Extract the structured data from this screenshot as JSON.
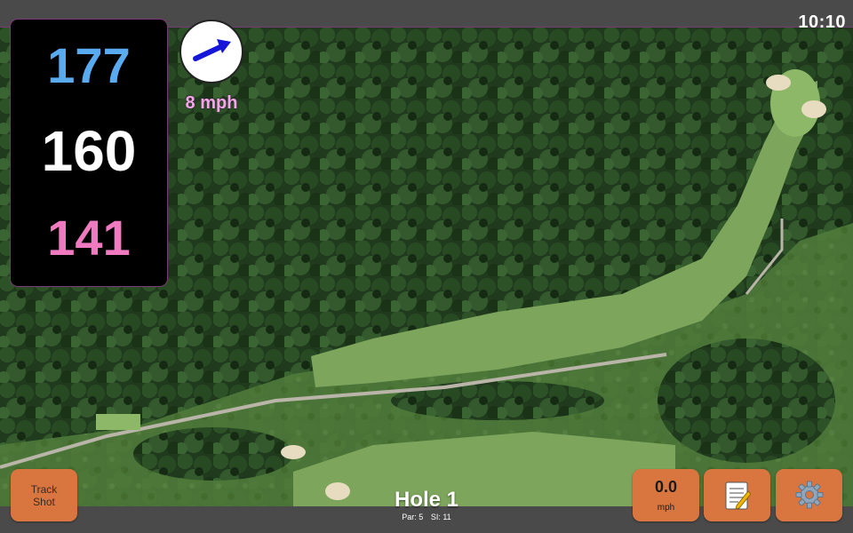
{
  "status_bar": {
    "clock": "10:10"
  },
  "yardage": {
    "back": "177",
    "center": "160",
    "front": "141"
  },
  "wind": {
    "speed": "8 mph",
    "icon": "arrow-icon"
  },
  "buttons": {
    "track_shot_line1": "Track",
    "track_shot_line2": "Shot",
    "speed_value": "0.0",
    "speed_unit": "mph",
    "notes_icon": "memo-icon",
    "settings_icon": "gear-icon"
  },
  "hole": {
    "title": "Hole 1",
    "par": "Par: 5",
    "si": "SI: 11"
  },
  "colors": {
    "back_yardage": "#5aaaf0",
    "center_yardage": "#ffffff",
    "front_yardage": "#f07ac0",
    "button": "#d9763f",
    "wind_text": "#f3a6e8"
  }
}
